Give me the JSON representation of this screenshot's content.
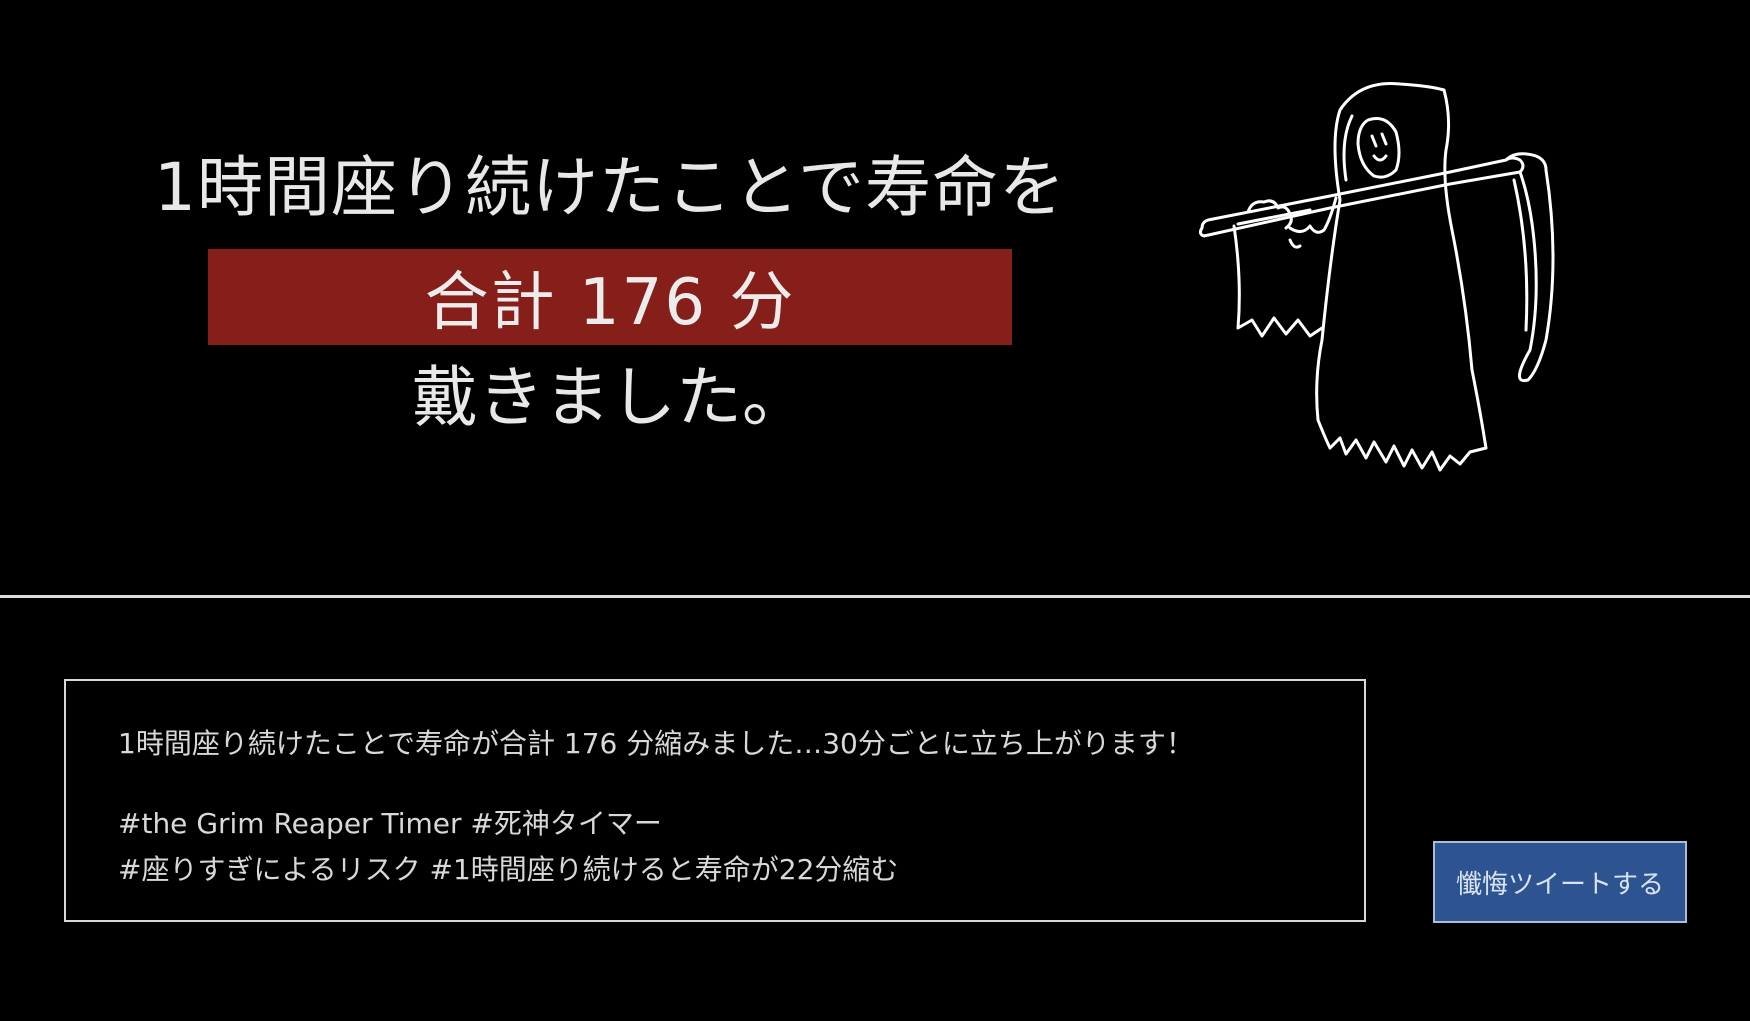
{
  "headline": {
    "line1": "1時間座り続けたことで寿命を",
    "highlight": "合計 176 分",
    "line3": "戴きました。"
  },
  "tweet": {
    "line1": "1時間座り続けたことで寿命が合計 176 分縮みました…30分ごとに立ち上がります！",
    "line2": "#the Grim Reaper Timer #死神タイマー",
    "line3": "#座りすぎによるリスク #1時間座り続けると寿命が22分縮む"
  },
  "button": {
    "label": "懺悔ツイートする"
  },
  "colors": {
    "background": "#000000",
    "highlight": "#861f19",
    "button": "#2d5491",
    "text": "#e6e6e6"
  },
  "icons": {
    "illustration": "grim-reaper-icon"
  }
}
